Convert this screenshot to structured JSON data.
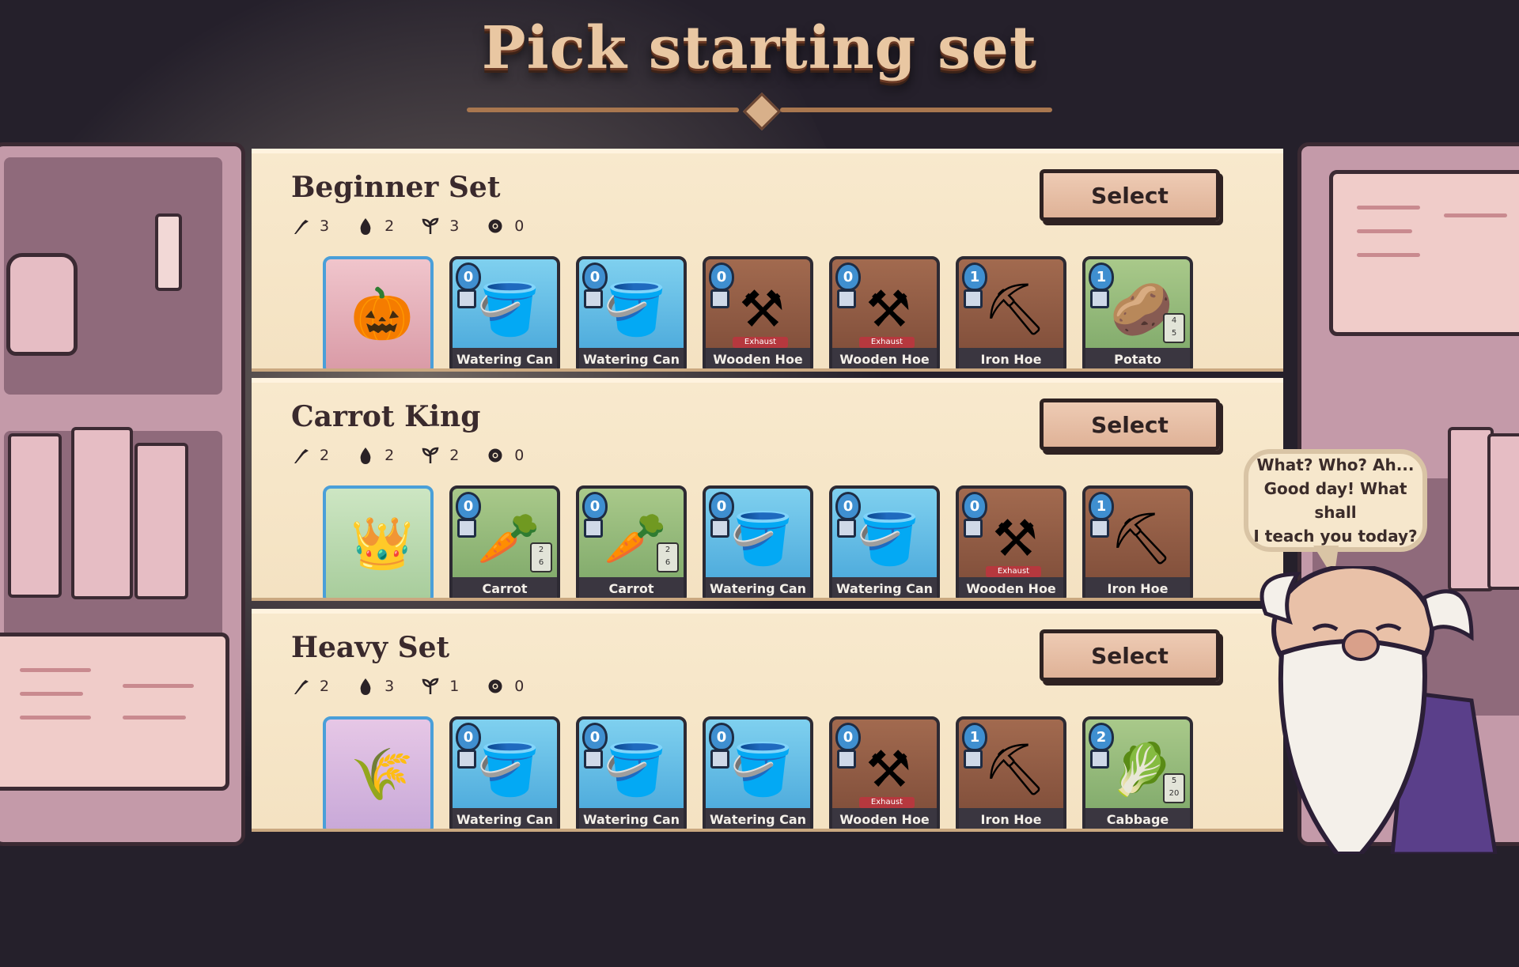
{
  "title": "Pick starting set",
  "select_label": "Select",
  "dialog": {
    "line1": "What? Who? Ah...",
    "line2": "Good day! What shall",
    "line3": "I teach you today?"
  },
  "stat_icons": [
    "hoe-icon",
    "water-drop-icon",
    "sprout-icon",
    "gear-icon"
  ],
  "sets": [
    {
      "name": "Beginner Set",
      "stats": [
        "3",
        "2",
        "3",
        "0"
      ],
      "hero": {
        "name": "pumpkin-merchant",
        "bg": "pink"
      },
      "cards": [
        {
          "cost": "0",
          "label": "Watering Can",
          "type": "watering-can"
        },
        {
          "cost": "0",
          "label": "Watering Can",
          "type": "watering-can"
        },
        {
          "cost": "0",
          "label": "Wooden Hoe",
          "type": "wooden-hoe",
          "tag": "Exhaust"
        },
        {
          "cost": "0",
          "label": "Wooden Hoe",
          "type": "wooden-hoe",
          "tag": "Exhaust"
        },
        {
          "cost": "1",
          "label": "Iron Hoe",
          "type": "iron-hoe"
        },
        {
          "cost": "1",
          "label": "Potato",
          "type": "potato",
          "grow": "4",
          "value": "5"
        }
      ]
    },
    {
      "name": "Carrot King",
      "stats": [
        "2",
        "2",
        "2",
        "0"
      ],
      "hero": {
        "name": "carrot-king",
        "bg": "mint"
      },
      "cards": [
        {
          "cost": "0",
          "label": "Carrot",
          "type": "carrot",
          "grow": "2",
          "value": "6"
        },
        {
          "cost": "0",
          "label": "Carrot",
          "type": "carrot",
          "grow": "2",
          "value": "6"
        },
        {
          "cost": "0",
          "label": "Watering Can",
          "type": "watering-can"
        },
        {
          "cost": "0",
          "label": "Watering Can",
          "type": "watering-can"
        },
        {
          "cost": "0",
          "label": "Wooden Hoe",
          "type": "wooden-hoe",
          "tag": "Exhaust"
        },
        {
          "cost": "1",
          "label": "Iron Hoe",
          "type": "iron-hoe"
        }
      ]
    },
    {
      "name": "Heavy Set",
      "stats": [
        "2",
        "3",
        "1",
        "0"
      ],
      "hero": {
        "name": "scarecrow",
        "bg": "lilac"
      },
      "cards": [
        {
          "cost": "0",
          "label": "Watering Can",
          "type": "watering-can"
        },
        {
          "cost": "0",
          "label": "Watering Can",
          "type": "watering-can"
        },
        {
          "cost": "0",
          "label": "Watering Can",
          "type": "watering-can"
        },
        {
          "cost": "0",
          "label": "Wooden Hoe",
          "type": "wooden-hoe",
          "tag": "Exhaust"
        },
        {
          "cost": "1",
          "label": "Iron Hoe",
          "type": "iron-hoe"
        },
        {
          "cost": "2",
          "label": "Cabbage",
          "type": "cabbage",
          "grow": "5",
          "value": "20"
        }
      ]
    }
  ]
}
